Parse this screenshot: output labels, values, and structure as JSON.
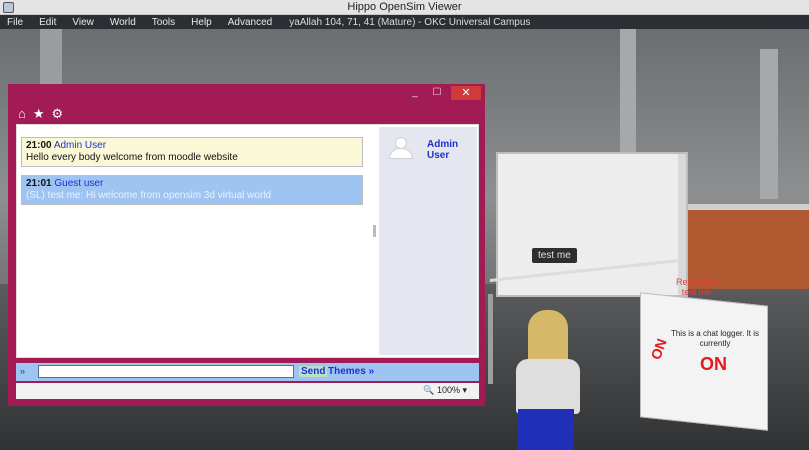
{
  "window": {
    "title": "Hippo OpenSim Viewer"
  },
  "menu": {
    "items": [
      "File",
      "Edit",
      "View",
      "World",
      "Tools",
      "Help",
      "Advanced"
    ],
    "location": "yaAllah 104, 71, 41 (Mature) - OKC Universal Campus"
  },
  "scene": {
    "avatar_tag": "test me",
    "recording_label": "Recording",
    "recording_sub": "test me",
    "cube_text": "This is a chat logger. It is currently",
    "cube_status": "ON",
    "cube_side": "ON"
  },
  "chat": {
    "window_controls": {
      "minimize": "_",
      "maximize": "☐",
      "close": "✕"
    },
    "nav_icons": {
      "home": "⌂",
      "favorite": "★",
      "settings": "⚙"
    },
    "messages": [
      {
        "time": "21:00",
        "user": "Admin User",
        "text": "Hello every body welcome from moodle website"
      },
      {
        "time": "21:01",
        "user": "Guest user",
        "text": "(SL) test me: Hi welcome from opensim 3d virtual world"
      }
    ],
    "users": [
      {
        "name": "Admin User"
      }
    ],
    "input": {
      "prompt": "»",
      "value": "",
      "send_label": "Send",
      "themes_label": "Themes »"
    },
    "zoom": "🔍 100%  ▾"
  },
  "colors": {
    "chat_frame": "#a21b54",
    "highlight_blue": "#9ec5f2",
    "message_yellow": "#fbf8d8",
    "link_blue": "#1f2fd0"
  }
}
